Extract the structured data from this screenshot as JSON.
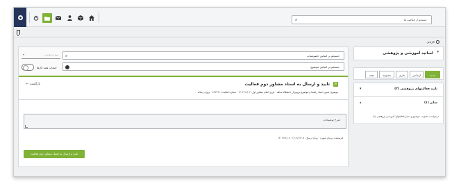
{
  "topbar": {
    "search_placeholder": "جستجو از فعالیت ها",
    "icons": [
      "power-icon",
      "folder-icon",
      "mail-icon",
      "user-icon",
      "box-icon",
      "home-icon"
    ]
  },
  "breadcrumb": {
    "label": "کارتابل"
  },
  "filters": {
    "search_by_attributes": "جستجو بر اساس خصوصیات",
    "search_by_subject": "جستجو بر اساس موضوع",
    "type_dropdown": "نوع درخواست",
    "select_all_label": "انتخاب همه کارها"
  },
  "activity": {
    "back_label": "بازگشت",
    "title": "تایید و ارسال به استاد مشاور دوم فعالیت",
    "meta": "موضوع: تعیین استاد راهنما و موضوع پروپوزال دانشگاه شاهد · تاریخ اعلام مشاور اول: ۱۴۰۲/۱۲/۰۶ · شماره فعالیت: ۸۴۲۳۱۲ · پروژه رساله",
    "description_placeholder": "شرح توضیحات",
    "sender": "فرستنده: پرنیان شهره · زمان ارسال: ۱۴۰۲/۱۲/۰۷ · ۱۴۰۲/۱۲/۰۸",
    "submit_label": "تایید و ارسال به استاد مشاور دوم فعالیت"
  },
  "right_panel": {
    "header": "اساتید آموزشی و پژوهشی",
    "tabs": [
      "جدید",
      "ارجاعی",
      "جاری",
      "مختومه",
      "همه"
    ],
    "items": [
      {
        "label": "تایید فعالیتهای پژوهشی (۲)"
      },
      {
        "label": "سایر (۱)"
      }
    ],
    "sub_item": "درخواست تصویب موضوع و سایر فعالیتهای آموزشی پژوهشی (۱)"
  }
}
